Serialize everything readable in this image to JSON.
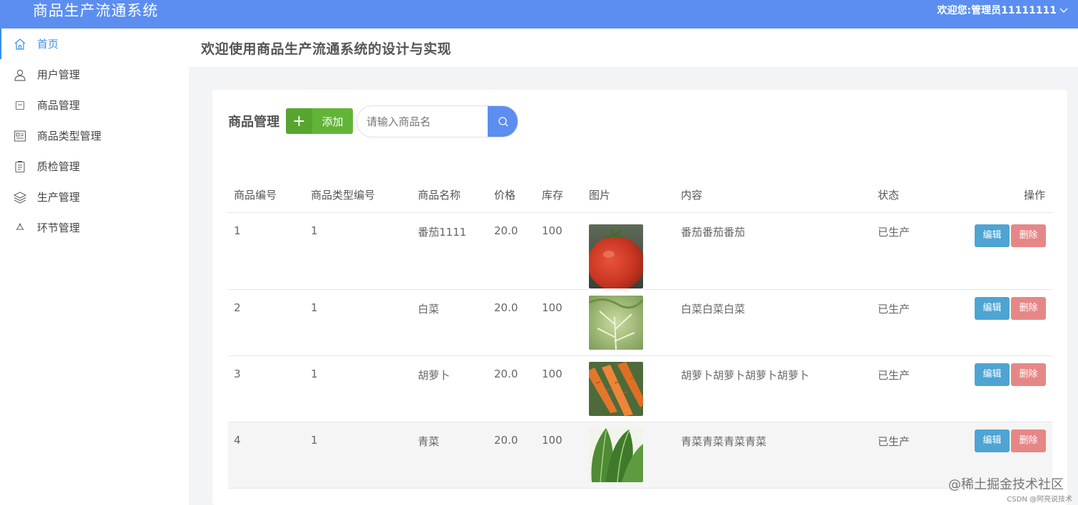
{
  "app": {
    "title": "商品生产流通系统",
    "user_label": "欢迎您:管理员11111111"
  },
  "sidebar": {
    "items": [
      {
        "label": "首页",
        "icon": "home-icon",
        "active": true
      },
      {
        "label": "用户管理",
        "icon": "user-icon"
      },
      {
        "label": "商品管理",
        "icon": "bag-icon"
      },
      {
        "label": "商品类型管理",
        "icon": "grid-icon"
      },
      {
        "label": "质检管理",
        "icon": "clipboard-icon"
      },
      {
        "label": "生产管理",
        "icon": "layers-icon"
      },
      {
        "label": "环节管理",
        "icon": "recycle-icon"
      }
    ]
  },
  "page": {
    "title": "欢迎使用商品生产流通系统的设计与实现"
  },
  "panel": {
    "title": "商品管理",
    "add_label": "添加",
    "search_placeholder": "请输入商品名"
  },
  "table": {
    "headers": [
      "商品编号",
      "商品类型编号",
      "商品名称",
      "价格",
      "库存",
      "图片",
      "内容",
      "状态",
      "操作"
    ],
    "edit_label": "编辑",
    "delete_label": "删除",
    "rows": [
      {
        "id": "1",
        "type_id": "1",
        "name": "番茄1111",
        "price": "20.0",
        "stock": "100",
        "image": "tomato",
        "content": "番茄番茄番茄",
        "status": "已生产"
      },
      {
        "id": "2",
        "type_id": "1",
        "name": "白菜",
        "price": "20.0",
        "stock": "100",
        "image": "cabbage",
        "content": "白菜白菜白菜",
        "status": "已生产"
      },
      {
        "id": "3",
        "type_id": "1",
        "name": "胡萝卜",
        "price": "20.0",
        "stock": "100",
        "image": "carrot",
        "content": "胡萝卜胡萝卜胡萝卜胡萝卜",
        "status": "已生产"
      },
      {
        "id": "4",
        "type_id": "1",
        "name": "青菜",
        "price": "20.0",
        "stock": "100",
        "image": "greens",
        "content": "青菜青菜青菜青菜",
        "status": "已生产"
      }
    ]
  },
  "watermark": {
    "main": "@稀土掘金技术社区",
    "sub": "CSDN @阿亮说技术"
  },
  "colors": {
    "topbar": "#5b8ef0",
    "accent": "#3d8ee8",
    "add": "#62b437",
    "edit": "#4ea4d2",
    "delete": "#e68787"
  }
}
